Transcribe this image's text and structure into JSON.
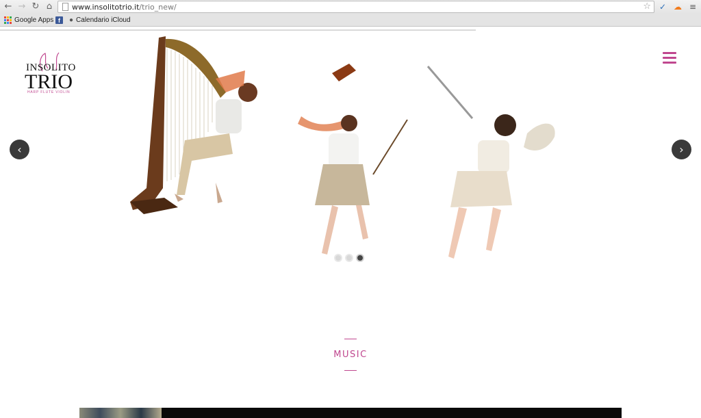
{
  "browser": {
    "url_domain": "www.insolitotrio.it",
    "url_path": "/trio_new/",
    "bookmarks": [
      {
        "label": "Google Apps",
        "icon": "apps-grid-icon"
      },
      {
        "label": "Calendario iCloud",
        "icon": "apple-icon"
      }
    ]
  },
  "site": {
    "logo": {
      "line1": "INSOLITO",
      "line2": "TRIO",
      "tagline": "HARP FLUTE VIOLIN"
    },
    "accent_color": "#c0478f",
    "slider": {
      "slide_count": 3,
      "active_slide": 3
    },
    "section": {
      "title": "MUSIC"
    }
  }
}
